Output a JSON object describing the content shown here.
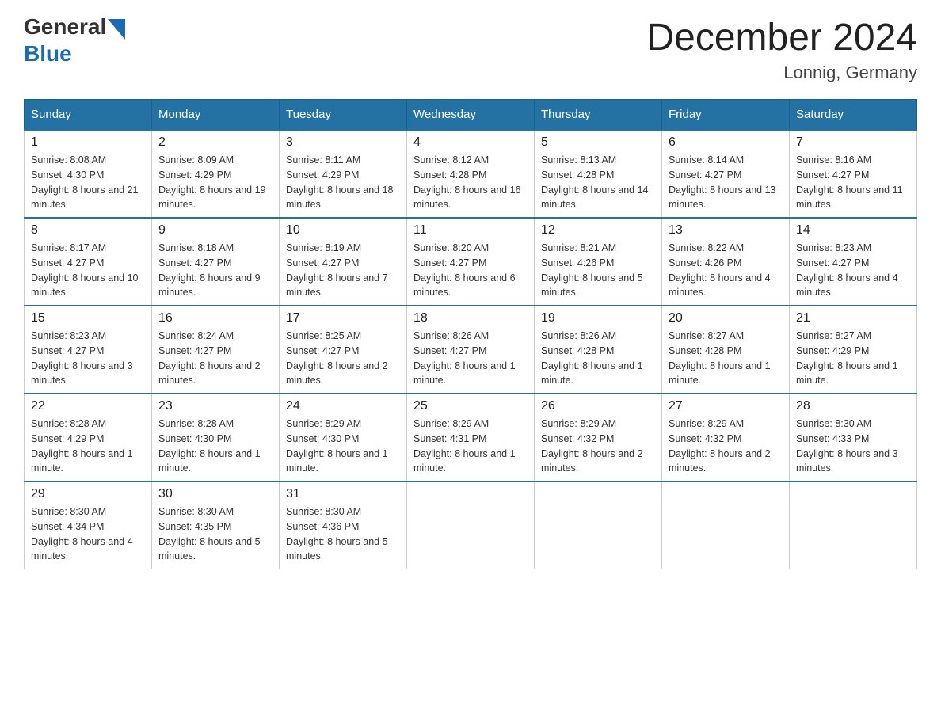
{
  "header": {
    "logo_general": "General",
    "logo_blue": "Blue",
    "month_title": "December 2024",
    "location": "Lonnig, Germany"
  },
  "weekdays": [
    "Sunday",
    "Monday",
    "Tuesday",
    "Wednesday",
    "Thursday",
    "Friday",
    "Saturday"
  ],
  "weeks": [
    [
      {
        "day": "1",
        "sunrise": "8:08 AM",
        "sunset": "4:30 PM",
        "daylight": "8 hours and 21 minutes."
      },
      {
        "day": "2",
        "sunrise": "8:09 AM",
        "sunset": "4:29 PM",
        "daylight": "8 hours and 19 minutes."
      },
      {
        "day": "3",
        "sunrise": "8:11 AM",
        "sunset": "4:29 PM",
        "daylight": "8 hours and 18 minutes."
      },
      {
        "day": "4",
        "sunrise": "8:12 AM",
        "sunset": "4:28 PM",
        "daylight": "8 hours and 16 minutes."
      },
      {
        "day": "5",
        "sunrise": "8:13 AM",
        "sunset": "4:28 PM",
        "daylight": "8 hours and 14 minutes."
      },
      {
        "day": "6",
        "sunrise": "8:14 AM",
        "sunset": "4:27 PM",
        "daylight": "8 hours and 13 minutes."
      },
      {
        "day": "7",
        "sunrise": "8:16 AM",
        "sunset": "4:27 PM",
        "daylight": "8 hours and 11 minutes."
      }
    ],
    [
      {
        "day": "8",
        "sunrise": "8:17 AM",
        "sunset": "4:27 PM",
        "daylight": "8 hours and 10 minutes."
      },
      {
        "day": "9",
        "sunrise": "8:18 AM",
        "sunset": "4:27 PM",
        "daylight": "8 hours and 9 minutes."
      },
      {
        "day": "10",
        "sunrise": "8:19 AM",
        "sunset": "4:27 PM",
        "daylight": "8 hours and 7 minutes."
      },
      {
        "day": "11",
        "sunrise": "8:20 AM",
        "sunset": "4:27 PM",
        "daylight": "8 hours and 6 minutes."
      },
      {
        "day": "12",
        "sunrise": "8:21 AM",
        "sunset": "4:26 PM",
        "daylight": "8 hours and 5 minutes."
      },
      {
        "day": "13",
        "sunrise": "8:22 AM",
        "sunset": "4:26 PM",
        "daylight": "8 hours and 4 minutes."
      },
      {
        "day": "14",
        "sunrise": "8:23 AM",
        "sunset": "4:27 PM",
        "daylight": "8 hours and 4 minutes."
      }
    ],
    [
      {
        "day": "15",
        "sunrise": "8:23 AM",
        "sunset": "4:27 PM",
        "daylight": "8 hours and 3 minutes."
      },
      {
        "day": "16",
        "sunrise": "8:24 AM",
        "sunset": "4:27 PM",
        "daylight": "8 hours and 2 minutes."
      },
      {
        "day": "17",
        "sunrise": "8:25 AM",
        "sunset": "4:27 PM",
        "daylight": "8 hours and 2 minutes."
      },
      {
        "day": "18",
        "sunrise": "8:26 AM",
        "sunset": "4:27 PM",
        "daylight": "8 hours and 1 minute."
      },
      {
        "day": "19",
        "sunrise": "8:26 AM",
        "sunset": "4:28 PM",
        "daylight": "8 hours and 1 minute."
      },
      {
        "day": "20",
        "sunrise": "8:27 AM",
        "sunset": "4:28 PM",
        "daylight": "8 hours and 1 minute."
      },
      {
        "day": "21",
        "sunrise": "8:27 AM",
        "sunset": "4:29 PM",
        "daylight": "8 hours and 1 minute."
      }
    ],
    [
      {
        "day": "22",
        "sunrise": "8:28 AM",
        "sunset": "4:29 PM",
        "daylight": "8 hours and 1 minute."
      },
      {
        "day": "23",
        "sunrise": "8:28 AM",
        "sunset": "4:30 PM",
        "daylight": "8 hours and 1 minute."
      },
      {
        "day": "24",
        "sunrise": "8:29 AM",
        "sunset": "4:30 PM",
        "daylight": "8 hours and 1 minute."
      },
      {
        "day": "25",
        "sunrise": "8:29 AM",
        "sunset": "4:31 PM",
        "daylight": "8 hours and 1 minute."
      },
      {
        "day": "26",
        "sunrise": "8:29 AM",
        "sunset": "4:32 PM",
        "daylight": "8 hours and 2 minutes."
      },
      {
        "day": "27",
        "sunrise": "8:29 AM",
        "sunset": "4:32 PM",
        "daylight": "8 hours and 2 minutes."
      },
      {
        "day": "28",
        "sunrise": "8:30 AM",
        "sunset": "4:33 PM",
        "daylight": "8 hours and 3 minutes."
      }
    ],
    [
      {
        "day": "29",
        "sunrise": "8:30 AM",
        "sunset": "4:34 PM",
        "daylight": "8 hours and 4 minutes."
      },
      {
        "day": "30",
        "sunrise": "8:30 AM",
        "sunset": "4:35 PM",
        "daylight": "8 hours and 5 minutes."
      },
      {
        "day": "31",
        "sunrise": "8:30 AM",
        "sunset": "4:36 PM",
        "daylight": "8 hours and 5 minutes."
      },
      null,
      null,
      null,
      null
    ]
  ]
}
